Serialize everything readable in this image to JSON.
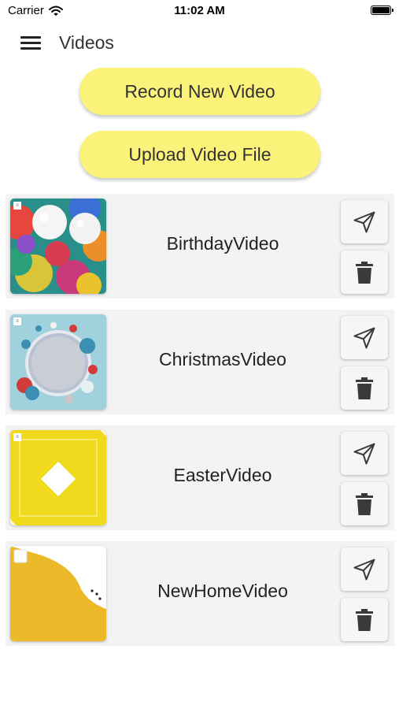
{
  "status_bar": {
    "carrier": "Carrier",
    "time": "11:02 AM",
    "wifi_icon": "wifi-icon",
    "battery_icon": "battery-icon"
  },
  "nav": {
    "title": "Videos",
    "menu_icon": "hamburger-menu-icon"
  },
  "actions": {
    "record_label": "Record New Video",
    "upload_label": "Upload Video File"
  },
  "colors": {
    "button_yellow": "#fbf27a",
    "card_background": "#f3f3f4",
    "icon_dark": "#3a3a3a"
  },
  "videos": [
    {
      "name": "BirthdayVideo",
      "thumbnail": "balloons",
      "send_icon": "send-icon",
      "delete_icon": "trash-icon"
    },
    {
      "name": "ChristmasVideo",
      "thumbnail": "ornament-wreath",
      "send_icon": "send-icon",
      "delete_icon": "trash-icon"
    },
    {
      "name": "EasterVideo",
      "thumbnail": "yellow-diamond",
      "send_icon": "send-icon",
      "delete_icon": "trash-icon"
    },
    {
      "name": "NewHomeVideo",
      "thumbnail": "yellow-wave",
      "send_icon": "send-icon",
      "delete_icon": "trash-icon"
    }
  ]
}
